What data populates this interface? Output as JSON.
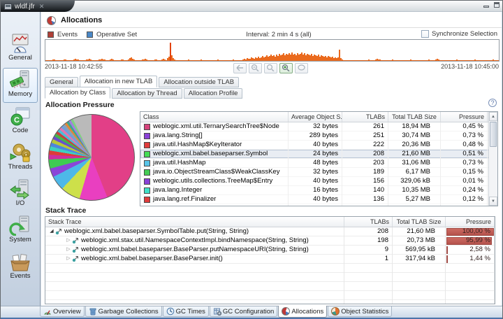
{
  "window": {
    "tab_title": "wldf.jfr"
  },
  "sidebar": {
    "items": [
      {
        "label": "General",
        "icon": "gauge"
      },
      {
        "label": "Memory",
        "icon": "memory",
        "selected": true
      },
      {
        "label": "Code",
        "icon": "code"
      },
      {
        "label": "Threads",
        "icon": "threads"
      },
      {
        "label": "I/O",
        "icon": "io"
      },
      {
        "label": "System",
        "icon": "system"
      },
      {
        "label": "Events",
        "icon": "events"
      }
    ]
  },
  "header": {
    "title": "Allocations"
  },
  "legend": {
    "events_label": "Events",
    "events_color": "#b04038",
    "operative_label": "Operative Set",
    "operative_color": "#4a88c7",
    "interval_label": "Interval: 2 min 4 s (all)",
    "synchronize_label": "Synchronize Selection",
    "synchronize_checked": false
  },
  "timeline": {
    "start_label": "2013-11-18 10:42:55",
    "end_label": "2013-11-18 10:45:00",
    "bar_color": "#ea6a1e",
    "spikes": [
      [
        6,
        1
      ],
      [
        10,
        2
      ],
      [
        12,
        2
      ],
      [
        14,
        1
      ],
      [
        20,
        1
      ],
      [
        26,
        2
      ],
      [
        28,
        2
      ],
      [
        30,
        1
      ],
      [
        36,
        1
      ],
      [
        40,
        2
      ],
      [
        42,
        3
      ],
      [
        44,
        2
      ],
      [
        46,
        2
      ],
      [
        48,
        1
      ],
      [
        54,
        1
      ],
      [
        58,
        2
      ],
      [
        60,
        2
      ],
      [
        62,
        3
      ],
      [
        64,
        2
      ],
      [
        66,
        1
      ],
      [
        72,
        1
      ],
      [
        76,
        2
      ],
      [
        78,
        2
      ],
      [
        80,
        3
      ],
      [
        82,
        2
      ],
      [
        84,
        2
      ],
      [
        86,
        1
      ],
      [
        92,
        2
      ],
      [
        94,
        3
      ],
      [
        96,
        2
      ],
      [
        98,
        1
      ],
      [
        104,
        1
      ],
      [
        108,
        2
      ],
      [
        110,
        2
      ],
      [
        112,
        1
      ],
      [
        118,
        2
      ],
      [
        120,
        4
      ],
      [
        122,
        5
      ],
      [
        124,
        3
      ],
      [
        126,
        2
      ],
      [
        128,
        1
      ],
      [
        134,
        1
      ],
      [
        138,
        2
      ],
      [
        140,
        2
      ],
      [
        142,
        3
      ],
      [
        144,
        2
      ],
      [
        146,
        1
      ],
      [
        152,
        1
      ],
      [
        156,
        2
      ],
      [
        158,
        2
      ],
      [
        160,
        1
      ],
      [
        166,
        2
      ],
      [
        168,
        3
      ],
      [
        170,
        2
      ],
      [
        174,
        4
      ],
      [
        176,
        6
      ],
      [
        178,
        26
      ],
      [
        180,
        8
      ],
      [
        182,
        4
      ],
      [
        184,
        2
      ],
      [
        186,
        1
      ],
      [
        192,
        1
      ],
      [
        198,
        1
      ],
      [
        204,
        2
      ],
      [
        206,
        1
      ],
      [
        214,
        1
      ],
      [
        222,
        2
      ],
      [
        224,
        1
      ],
      [
        232,
        1
      ],
      [
        240,
        1
      ],
      [
        246,
        2
      ],
      [
        248,
        1
      ],
      [
        256,
        1
      ],
      [
        262,
        1
      ],
      [
        268,
        2
      ],
      [
        270,
        1
      ],
      [
        278,
        1
      ],
      [
        282,
        2
      ],
      [
        284,
        3
      ],
      [
        286,
        2
      ],
      [
        288,
        4
      ],
      [
        290,
        3
      ],
      [
        292,
        3
      ],
      [
        294,
        5
      ],
      [
        296,
        4
      ],
      [
        298,
        3
      ],
      [
        300,
        5
      ],
      [
        302,
        4
      ],
      [
        304,
        6
      ],
      [
        306,
        4
      ],
      [
        308,
        5
      ],
      [
        310,
        7
      ],
      [
        312,
        5
      ],
      [
        314,
        6
      ],
      [
        316,
        8
      ],
      [
        318,
        6
      ],
      [
        320,
        7
      ],
      [
        322,
        9
      ],
      [
        324,
        7
      ],
      [
        326,
        8
      ],
      [
        328,
        6
      ],
      [
        330,
        9
      ],
      [
        332,
        7
      ],
      [
        334,
        10
      ],
      [
        336,
        8
      ],
      [
        338,
        9
      ],
      [
        340,
        11
      ],
      [
        342,
        8
      ],
      [
        344,
        10
      ],
      [
        346,
        9
      ],
      [
        348,
        11
      ],
      [
        350,
        9
      ],
      [
        352,
        12
      ],
      [
        354,
        9
      ],
      [
        356,
        10
      ],
      [
        358,
        8
      ],
      [
        360,
        11
      ],
      [
        362,
        9
      ],
      [
        364,
        10
      ],
      [
        366,
        12
      ],
      [
        368,
        9
      ],
      [
        370,
        11
      ],
      [
        372,
        8
      ],
      [
        374,
        10
      ],
      [
        376,
        9
      ],
      [
        378,
        8
      ],
      [
        380,
        10
      ],
      [
        382,
        7
      ],
      [
        384,
        9
      ],
      [
        386,
        8
      ],
      [
        388,
        7
      ],
      [
        390,
        9
      ],
      [
        392,
        6
      ],
      [
        394,
        8
      ],
      [
        396,
        7
      ],
      [
        398,
        6
      ],
      [
        400,
        7
      ],
      [
        402,
        5
      ],
      [
        404,
        7
      ],
      [
        406,
        6
      ],
      [
        408,
        5
      ],
      [
        410,
        6
      ],
      [
        412,
        4
      ],
      [
        414,
        5
      ],
      [
        416,
        4
      ],
      [
        418,
        5
      ],
      [
        420,
        16
      ],
      [
        422,
        4
      ],
      [
        424,
        2
      ],
      [
        430,
        1
      ],
      [
        438,
        1
      ],
      [
        448,
        1
      ],
      [
        456,
        1
      ],
      [
        462,
        2
      ],
      [
        464,
        1
      ],
      [
        472,
        2
      ],
      [
        474,
        3
      ],
      [
        476,
        2
      ],
      [
        478,
        2
      ],
      [
        480,
        1
      ],
      [
        488,
        1
      ],
      [
        496,
        2
      ],
      [
        498,
        1
      ],
      [
        506,
        1
      ],
      [
        514,
        1
      ],
      [
        522,
        2
      ],
      [
        524,
        1
      ],
      [
        532,
        1
      ],
      [
        540,
        1
      ],
      [
        548,
        2
      ],
      [
        550,
        1
      ],
      [
        558,
        2
      ],
      [
        560,
        3
      ],
      [
        562,
        2
      ],
      [
        564,
        1
      ],
      [
        572,
        1
      ],
      [
        580,
        1
      ],
      [
        588,
        2
      ],
      [
        590,
        1
      ],
      [
        598,
        1
      ],
      [
        606,
        1
      ],
      [
        614,
        2
      ],
      [
        616,
        1
      ],
      [
        624,
        1
      ],
      [
        632,
        1
      ],
      [
        640,
        2
      ],
      [
        642,
        1
      ],
      [
        648,
        1
      ]
    ]
  },
  "toolbar": {
    "buttons": [
      {
        "icon": "nav-back",
        "enabled": false
      },
      {
        "icon": "zoom-out",
        "enabled": false
      },
      {
        "icon": "zoom-range",
        "enabled": false
      },
      {
        "icon": "zoom-in",
        "enabled": true,
        "active": true
      },
      {
        "icon": "zoom-reset",
        "enabled": false
      }
    ]
  },
  "tabs_primary": [
    {
      "label": "General"
    },
    {
      "label": "Allocation in new TLAB",
      "selected": true
    },
    {
      "label": "Allocation outside TLAB"
    }
  ],
  "tabs_secondary": [
    {
      "label": "Allocation by Class",
      "selected": true
    },
    {
      "label": "Allocation by Thread"
    },
    {
      "label": "Allocation Profile"
    }
  ],
  "allocation_pressure": {
    "section_title": "Allocation Pressure",
    "columns": [
      "Class",
      "Average Object S...",
      "TLABs",
      "Total TLAB Size",
      "Pressure"
    ],
    "rows": [
      {
        "color": "#d6437c",
        "class": "weblogic.xml.util.TernarySearchTree$Node",
        "avg": "32 bytes",
        "tlabs": "261",
        "size": "18,94 MB",
        "pressure": "0,45 %"
      },
      {
        "color": "#8a41d8",
        "class": "java.lang.String[]",
        "avg": "289 bytes",
        "tlabs": "251",
        "size": "30,74 MB",
        "pressure": "0,73 %"
      },
      {
        "color": "#e03c3c",
        "class": "java.util.HashMap$KeyIterator",
        "avg": "40 bytes",
        "tlabs": "222",
        "size": "20,36 MB",
        "pressure": "0,48 %"
      },
      {
        "color": "#44dd55",
        "class": "weblogic.xml.babel.baseparser.Symbol",
        "avg": "24 bytes",
        "tlabs": "208",
        "size": "21,60 MB",
        "pressure": "0,51 %",
        "selected": true
      },
      {
        "color": "#58c4e8",
        "class": "java.util.HashMap",
        "avg": "48 bytes",
        "tlabs": "203",
        "size": "31,06 MB",
        "pressure": "0,73 %"
      },
      {
        "color": "#44cc55",
        "class": "java.io.ObjectStreamClass$WeakClassKey",
        "avg": "32 bytes",
        "tlabs": "189",
        "size": "6,17 MB",
        "pressure": "0,15 %"
      },
      {
        "color": "#8a41d8",
        "class": "weblogic.utils.collections.TreeMap$Entry",
        "avg": "40 bytes",
        "tlabs": "156",
        "size": "329,06 kB",
        "pressure": "0,01 %"
      },
      {
        "color": "#40e0c8",
        "class": "java.lang.Integer",
        "avg": "16 bytes",
        "tlabs": "140",
        "size": "10,35 MB",
        "pressure": "0,24 %"
      },
      {
        "color": "#e03c3c",
        "class": "java.lang.ref.Finalizer",
        "avg": "40 bytes",
        "tlabs": "136",
        "size": "5,27 MB",
        "pressure": "0,12 %"
      },
      {
        "color": "#e0603c",
        "class": "",
        "avg": "",
        "tlabs": "",
        "size": "",
        "pressure": ""
      }
    ],
    "pie_slices": [
      {
        "color": "#e23f87",
        "pct": 44
      },
      {
        "color": "#e93fc0",
        "pct": 10.5
      },
      {
        "color": "#cde04a",
        "pct": 7.5
      },
      {
        "color": "#4db8e8",
        "pct": 5.5
      },
      {
        "color": "#8a46d8",
        "pct": 3.3
      },
      {
        "color": "#3ecc52",
        "pct": 3.4
      },
      {
        "color": "#cc2f9f",
        "pct": 1.8
      },
      {
        "color": "#dd3c38",
        "pct": 1.6
      },
      {
        "color": "#3ed0c0",
        "pct": 1.6
      },
      {
        "color": "#4f86dd",
        "pct": 1.4
      },
      {
        "color": "#b8c838",
        "pct": 1.4
      },
      {
        "color": "#6a50cc",
        "pct": 1.2
      },
      {
        "color": "#46b44e",
        "pct": 1.2
      },
      {
        "color": "#c84040",
        "pct": 1.0
      },
      {
        "color": "#48c0d8",
        "pct": 1.0
      },
      {
        "color": "#e078b0",
        "pct": 1.0
      },
      {
        "color": "#6aa0e0",
        "pct": 0.9
      },
      {
        "color": "#8aa0b8",
        "pct": 0.9
      },
      {
        "color": "#e08838",
        "pct": 0.9
      },
      {
        "color": "#3aa890",
        "pct": 0.9
      },
      {
        "color": "#a080e0",
        "pct": 0.9
      },
      {
        "color": "#82d082",
        "pct": 0.9
      },
      {
        "color": "#bababa",
        "pct": 7.2
      }
    ]
  },
  "stack_trace": {
    "section_title": "Stack Trace",
    "columns": [
      "Stack Trace",
      "TLABs",
      "Total TLAB Size",
      "Pressure"
    ],
    "rows": [
      {
        "method": "weblogic.xml.babel.baseparser.SymbolTable.put(String, String)",
        "tlabs": "208",
        "size": "21,60 MB",
        "pressure": "100,00 %",
        "bar": 100,
        "expanded": true,
        "indent": 0
      },
      {
        "method": "weblogic.xml.stax.util.NamespaceContextImpl.bindNamespace(String, String)",
        "tlabs": "198",
        "size": "20,73 MB",
        "pressure": "95,99 %",
        "bar": 96,
        "expanded": false,
        "indent": 1
      },
      {
        "method": "weblogic.xml.babel.baseparser.BaseParser.putNamespaceURI(String, String)",
        "tlabs": "9",
        "size": "569,95 kB",
        "pressure": "2,58 %",
        "bar": 2.6,
        "expanded": false,
        "indent": 1
      },
      {
        "method": "weblogic.xml.babel.baseparser.BaseParser.init()",
        "tlabs": "1",
        "size": "317,94 kB",
        "pressure": "1,44 %",
        "bar": 1.4,
        "expanded": false,
        "indent": 1
      }
    ]
  },
  "bottom_tabs": [
    {
      "label": "Overview",
      "icon": "overview"
    },
    {
      "label": "Garbage Collections",
      "icon": "gc"
    },
    {
      "label": "GC Times",
      "icon": "gctimes"
    },
    {
      "label": "GC Configuration",
      "icon": "gcconfig"
    },
    {
      "label": "Allocations",
      "icon": "alloc",
      "selected": true
    },
    {
      "label": "Object Statistics",
      "icon": "objstats"
    }
  ]
}
